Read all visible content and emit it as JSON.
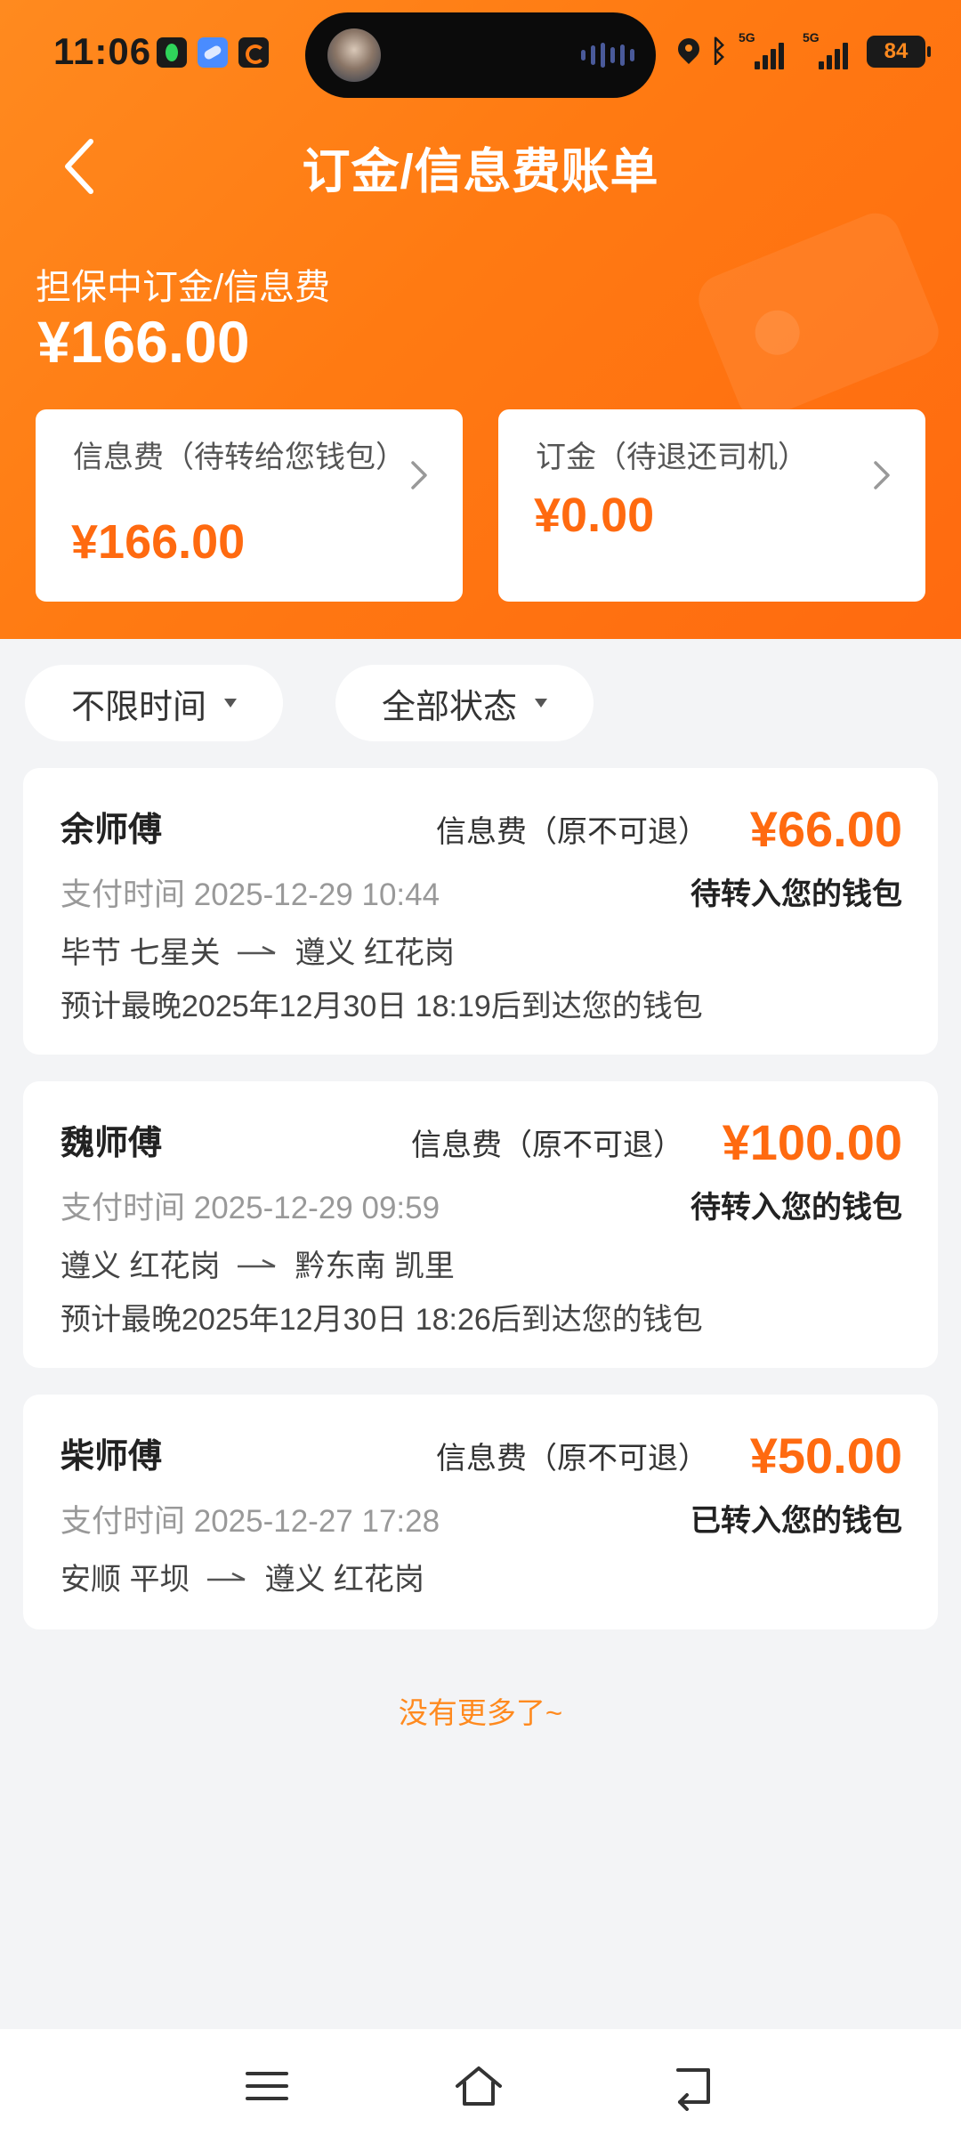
{
  "status_bar": {
    "time": "11:06",
    "network_1": "5G",
    "network_2": "5G",
    "battery": "84",
    "accent": "#ff7a12"
  },
  "header": {
    "title": "订金/信息费账单",
    "escrow_label": "担保中订金/信息费",
    "escrow_amount": "¥166.00"
  },
  "summary": {
    "info_fee": {
      "label": "信息费（待转给您钱包）",
      "amount": "¥166.00"
    },
    "deposit": {
      "label": "订金（待退还司机）",
      "amount": "¥0.00"
    }
  },
  "filters": {
    "time": "不限时间",
    "status": "全部状态"
  },
  "records": [
    {
      "driver": "余师傅",
      "fee_type": "信息费（原不可退）",
      "amount": "¥66.00",
      "pay_time": "支付时间 2025-12-29 10:44",
      "status": "待转入您的钱包",
      "from": "毕节 七星关",
      "to": "遵义 红花岗",
      "eta": "预计最晚2025年12月30日 18:19后到达您的钱包"
    },
    {
      "driver": "魏师傅",
      "fee_type": "信息费（原不可退）",
      "amount": "¥100.00",
      "pay_time": "支付时间 2025-12-29 09:59",
      "status": "待转入您的钱包",
      "from": "遵义 红花岗",
      "to": "黔东南 凯里",
      "eta": "预计最晚2025年12月30日 18:26后到达您的钱包"
    },
    {
      "driver": "柴师傅",
      "fee_type": "信息费（原不可退）",
      "amount": "¥50.00",
      "pay_time": "支付时间 2025-12-27 17:28",
      "status": "已转入您的钱包",
      "from": "安顺 平坝",
      "to": "遵义 红花岗"
    }
  ],
  "footer": {
    "no_more": "没有更多了~"
  },
  "bottom_nav": {
    "icons": [
      "menu-icon",
      "home-icon",
      "back-icon"
    ]
  }
}
